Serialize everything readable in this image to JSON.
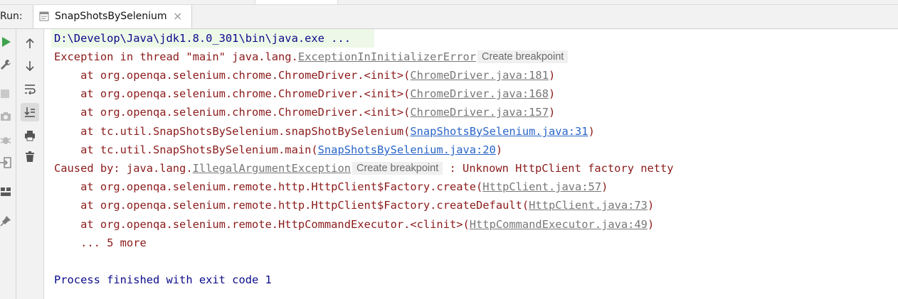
{
  "run_bar": {
    "label": "Run:",
    "tab": {
      "title": "SnapShotsBySelenium",
      "close_glyph": "×"
    }
  },
  "left_strip_icons": [
    "run-icon",
    "wrench-icon",
    "stop-icon",
    "camera-icon",
    "debug-icon",
    "login-icon",
    "layout-icon",
    "pin-icon"
  ],
  "tool_icons": [
    "up-arrow-icon",
    "down-arrow-icon",
    "soft-wrap-icon",
    "scroll-to-end-icon",
    "print-icon",
    "trash-icon"
  ],
  "console": {
    "command_line": "D:\\Develop\\Java\\jdk1.8.0_301\\bin\\java.exe ...",
    "exception": {
      "prefix": "Exception in thread \"main\" java.lang.",
      "class_link": "ExceptionInInitializerError",
      "breakpoint_label": "Create breakpoint"
    },
    "trace1": [
      {
        "text": "    at org.openqa.selenium.chrome.ChromeDriver.<init>(",
        "link": "ChromeDriver.java:181",
        "link_style": "gray",
        "suffix": ")"
      },
      {
        "text": "    at org.openqa.selenium.chrome.ChromeDriver.<init>(",
        "link": "ChromeDriver.java:168",
        "link_style": "gray",
        "suffix": ")"
      },
      {
        "text": "    at org.openqa.selenium.chrome.ChromeDriver.<init>(",
        "link": "ChromeDriver.java:157",
        "link_style": "gray",
        "suffix": ")"
      },
      {
        "text": "    at tc.util.SnapShotsBySelenium.snapShotBySelenium(",
        "link": "SnapShotsBySelenium.java:31",
        "link_style": "blue",
        "suffix": ")"
      },
      {
        "text": "    at tc.util.SnapShotsBySelenium.main(",
        "link": "SnapShotsBySelenium.java:20",
        "link_style": "blue",
        "suffix": ")"
      }
    ],
    "caused_by": {
      "prefix": "Caused by: java.lang.",
      "class_link": "IllegalArgumentException",
      "breakpoint_label": "Create breakpoint",
      "message": " : Unknown HttpClient factory netty"
    },
    "trace2": [
      {
        "text": "    at org.openqa.selenium.remote.http.HttpClient$Factory.create(",
        "link": "HttpClient.java:57",
        "link_style": "gray",
        "suffix": ")"
      },
      {
        "text": "    at org.openqa.selenium.remote.http.HttpClient$Factory.createDefault(",
        "link": "HttpClient.java:73",
        "link_style": "gray",
        "suffix": ")"
      },
      {
        "text": "    at org.openqa.selenium.remote.HttpCommandExecutor.<clinit>(",
        "link": "HttpCommandExecutor.java:49",
        "link_style": "gray",
        "suffix": ")"
      }
    ],
    "more_line": "    ... 5 more",
    "process_line": "Process finished with exit code 1"
  }
}
